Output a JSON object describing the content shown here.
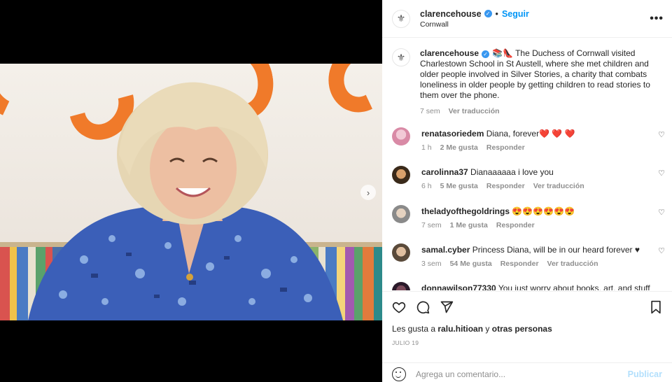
{
  "post": {
    "username": "clarencehouse",
    "follow_label": "Seguir",
    "separator": "•",
    "location": "Cornwall",
    "caption_emojis": "📚👠",
    "caption_text": "The Duchess of Cornwall visited Charlestown School in St Austell, where she met children and older people involved in Silver Stories, a charity that combats loneliness in older people by getting children to read stories to them over the phone.",
    "caption_time": "7 sem",
    "caption_translate": "Ver traducción"
  },
  "comments": [
    {
      "user": "renatasoriedem",
      "text": "Diana, forever",
      "emoji": "❤️ ❤️ ❤️",
      "time": "1 h",
      "likes": "2 Me gusta",
      "reply": "Responder",
      "translate": ""
    },
    {
      "user": "carolinna37",
      "text": "Dianaaaaaa i love you",
      "emoji": "",
      "time": "6 h",
      "likes": "5 Me gusta",
      "reply": "Responder",
      "translate": "Ver traducción"
    },
    {
      "user": "theladyofthegoldrings",
      "text": "",
      "emoji": "😍😍😍😍😍😍",
      "time": "7 sem",
      "likes": "1 Me gusta",
      "reply": "Responder",
      "translate": ""
    },
    {
      "user": "samal.cyber",
      "text": "Princess Diana, will be in our heard forever",
      "emoji": "♥",
      "time": "3 sem",
      "likes": "54 Me gusta",
      "reply": "Responder",
      "translate": "Ver traducción"
    },
    {
      "user": "donnawilson77330",
      "text": "You just worry about books, art, and stuff",
      "emoji": "",
      "time": "",
      "likes": "",
      "reply": "",
      "translate": ""
    }
  ],
  "likes_line": {
    "prefix": "Les gusta a",
    "user": "ralu.hitioan",
    "conj": "y",
    "others": "otras personas"
  },
  "date": "JULIO 19",
  "composer": {
    "placeholder": "Agrega un comentario...",
    "publish_label": "Publicar"
  },
  "icons": {
    "more": "more-options-icon",
    "like": "heart-icon",
    "comment": "comment-icon",
    "share": "share-icon",
    "save": "bookmark-icon",
    "emoji": "emoji-icon",
    "next": "chevron-right-icon"
  },
  "colors": {
    "link_blue": "#0095f6",
    "verified_blue": "#3897f0",
    "heart_red": "#ed4956",
    "publish_disabled": "#b2dffc",
    "dress_blue": "#3b5fb8",
    "tentacle_orange": "#f07a2a"
  }
}
